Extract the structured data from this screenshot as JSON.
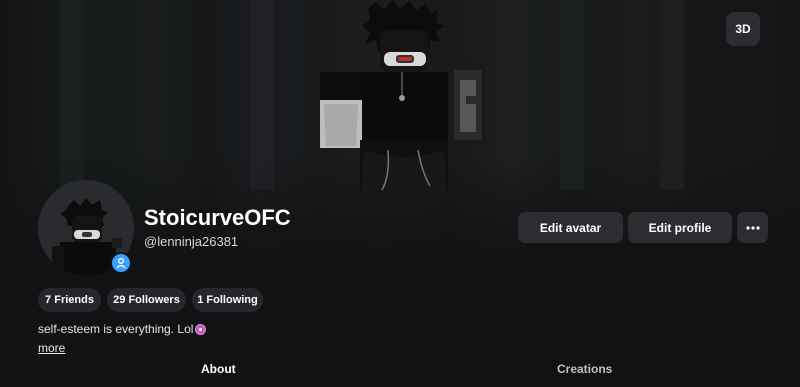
{
  "banner": {
    "view_3d_label": "3D"
  },
  "profile": {
    "display_name": "StoicurveOFC",
    "username": "@lenninja26381",
    "bio_text": "self-esteem is everything. Lol",
    "bio_emoji_icon": "sparkle-heart-emoji",
    "more_label": "more",
    "badge_icon": "user-verified-icon"
  },
  "actions": {
    "edit_avatar_label": "Edit avatar",
    "edit_profile_label": "Edit profile",
    "more_options_icon": "ellipsis-icon"
  },
  "stats": {
    "friends_label": "7 Friends",
    "followers_label": "29 Followers",
    "following_label": "1 Following"
  },
  "tabs": {
    "about_label": "About",
    "creations_label": "Creations"
  },
  "colors": {
    "background": "#111214",
    "button_bg": "#2b2d30",
    "pill_bg": "#25272a",
    "badge_blue": "#3aa0ff"
  }
}
